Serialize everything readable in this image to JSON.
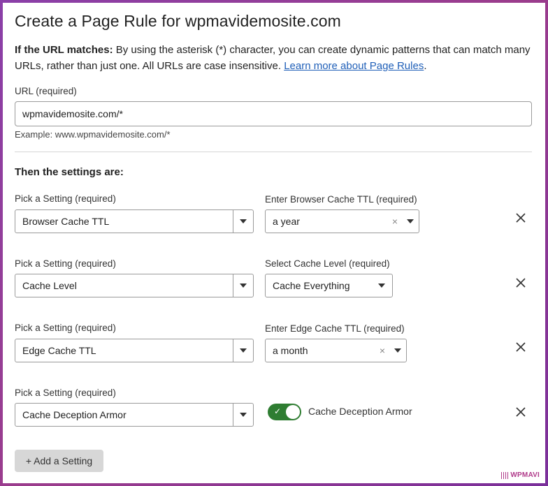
{
  "page": {
    "title": "Create a Page Rule for wpmavidemosite.com",
    "intro_bold": "If the URL matches:",
    "intro_text": " By using the asterisk (*) character, you can create dynamic patterns that can match many URLs, rather than just one. All URLs are case insensitive. ",
    "intro_link": "Learn more about Page Rules",
    "intro_end": "."
  },
  "url": {
    "label": "URL (required)",
    "value": "wpmavidemosite.com/*",
    "example": "Example: www.wpmavidemosite.com/*"
  },
  "settings_heading": "Then the settings are:",
  "rules": [
    {
      "setting_label": "Pick a Setting (required)",
      "setting_value": "Browser Cache TTL",
      "value_label": "Enter Browser Cache TTL (required)",
      "value": "a year",
      "clear_icon": "×"
    },
    {
      "setting_label": "Pick a Setting (required)",
      "setting_value": "Cache Level",
      "value_label": "Select Cache Level (required)",
      "value": "Cache Everything"
    },
    {
      "setting_label": "Pick a Setting (required)",
      "setting_value": "Edge Cache TTL",
      "value_label": "Enter Edge Cache TTL (required)",
      "value": "a month",
      "clear_icon": "×"
    },
    {
      "setting_label": "Pick a Setting (required)",
      "setting_value": "Cache Deception Armor",
      "toggle_label": "Cache Deception Armor",
      "toggle_on": true
    }
  ],
  "add_button": "+ Add a Setting",
  "watermark": "WPMAVI",
  "colors": {
    "link": "#1f5fb8",
    "toggle_on": "#2f7d32",
    "border": "#9a9a9a"
  }
}
